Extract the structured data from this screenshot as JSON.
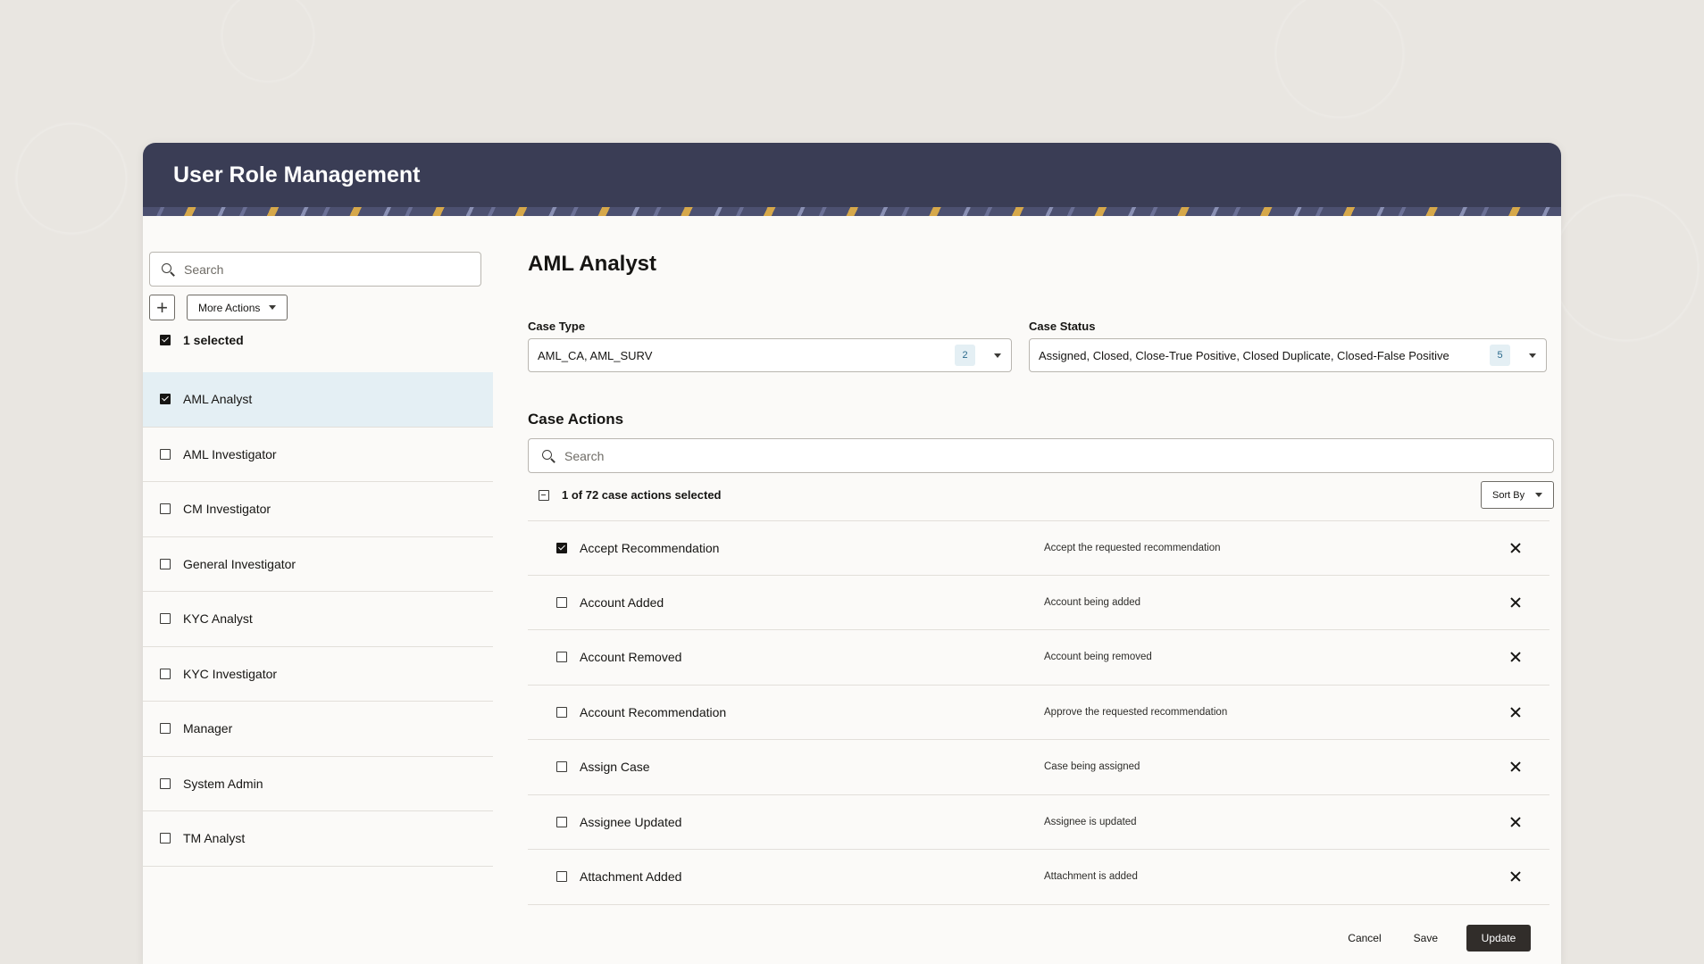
{
  "dialog": {
    "title": "User Role Management"
  },
  "left": {
    "search_placeholder": "Search",
    "add_label": "+",
    "more_actions_label": "More Actions",
    "selected_text": "1 selected",
    "roles": [
      {
        "label": "AML Analyst",
        "checked": true
      },
      {
        "label": "AML Investigator",
        "checked": false
      },
      {
        "label": "CM Investigator",
        "checked": false
      },
      {
        "label": "General Investigator",
        "checked": false
      },
      {
        "label": "KYC Analyst",
        "checked": false
      },
      {
        "label": "KYC Investigator",
        "checked": false
      },
      {
        "label": "Manager",
        "checked": false
      },
      {
        "label": "System Admin",
        "checked": false
      },
      {
        "label": "TM Analyst",
        "checked": false
      }
    ]
  },
  "main": {
    "title": "AML Analyst",
    "case_type": {
      "label": "Case Type",
      "value": "AML_CA, AML_SURV",
      "count": "2"
    },
    "case_status": {
      "label": "Case Status",
      "value": "Assigned, Closed, Close-True Positive, Closed Duplicate, Closed-False Positive",
      "count": "5"
    },
    "case_actions": {
      "title": "Case Actions",
      "search_placeholder": "Search",
      "selected_text": "1 of 72 case actions selected",
      "sort_label": "Sort By",
      "rows": [
        {
          "name": "Accept Recommendation",
          "description": "Accept the requested recommendation",
          "checked": true
        },
        {
          "name": "Account Added",
          "description": "Account being added",
          "checked": false
        },
        {
          "name": "Account Removed",
          "description": "Account being removed",
          "checked": false
        },
        {
          "name": "Account Recommendation",
          "description": "Approve the requested recommendation",
          "checked": false
        },
        {
          "name": "Assign Case",
          "description": "Case being assigned",
          "checked": false
        },
        {
          "name": "Assignee Updated",
          "description": "Assignee is updated",
          "checked": false
        },
        {
          "name": "Attachment Added",
          "description": "Attachment is added",
          "checked": false
        }
      ]
    }
  },
  "footer": {
    "cancel_label": "Cancel",
    "save_label": "Save",
    "update_label": "Update"
  },
  "colors": {
    "header_bg": "#3a3d55",
    "active_row": "#e4eff4",
    "primary_button": "#312d2a"
  }
}
